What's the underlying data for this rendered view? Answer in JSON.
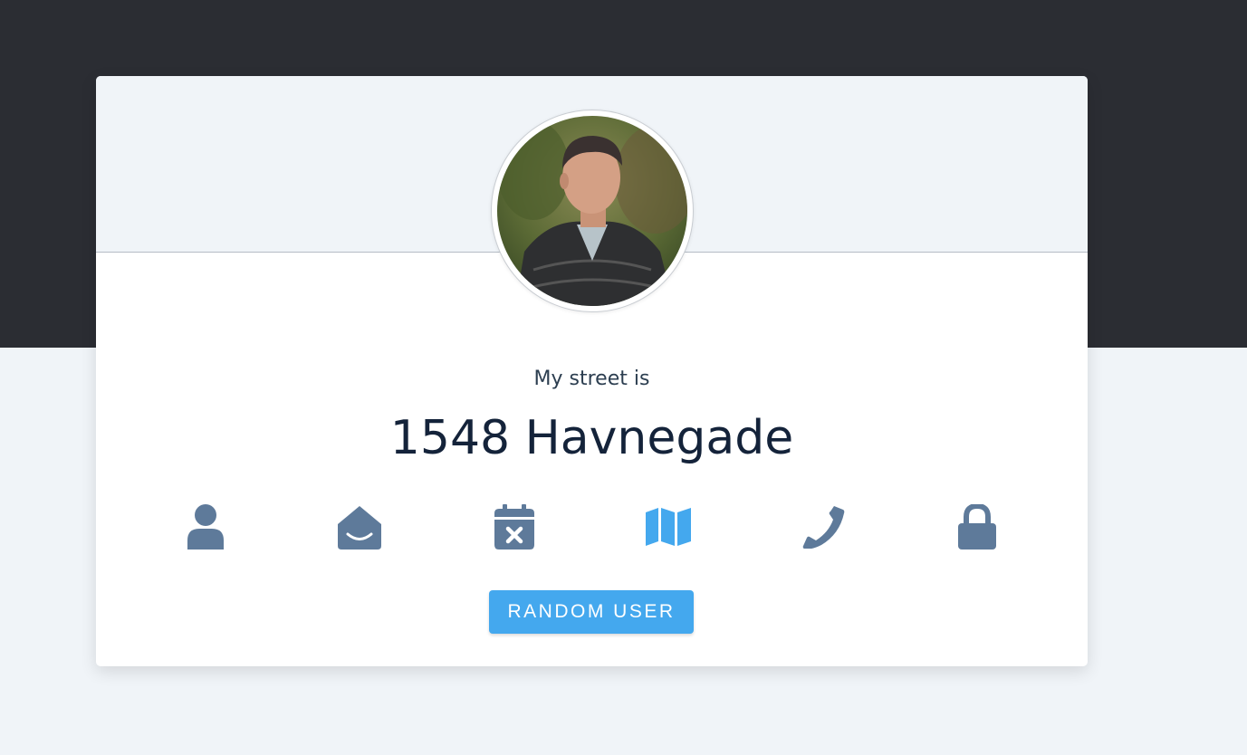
{
  "profile": {
    "label": "My street is",
    "value": "1548 Havnegade",
    "avatar": "user-portrait-photo"
  },
  "icons": [
    {
      "name": "person-icon",
      "active": false
    },
    {
      "name": "envelope-open-icon",
      "active": false
    },
    {
      "name": "calendar-times-icon",
      "active": false
    },
    {
      "name": "map-icon",
      "active": true
    },
    {
      "name": "phone-icon",
      "active": false
    },
    {
      "name": "lock-icon",
      "active": false
    }
  ],
  "colors": {
    "icon_default": "#5e7a9a",
    "icon_active": "#44a8ee",
    "button": "#44a8ee",
    "dark_band": "#2b2d33"
  },
  "button": {
    "label": "RANDOM USER"
  }
}
